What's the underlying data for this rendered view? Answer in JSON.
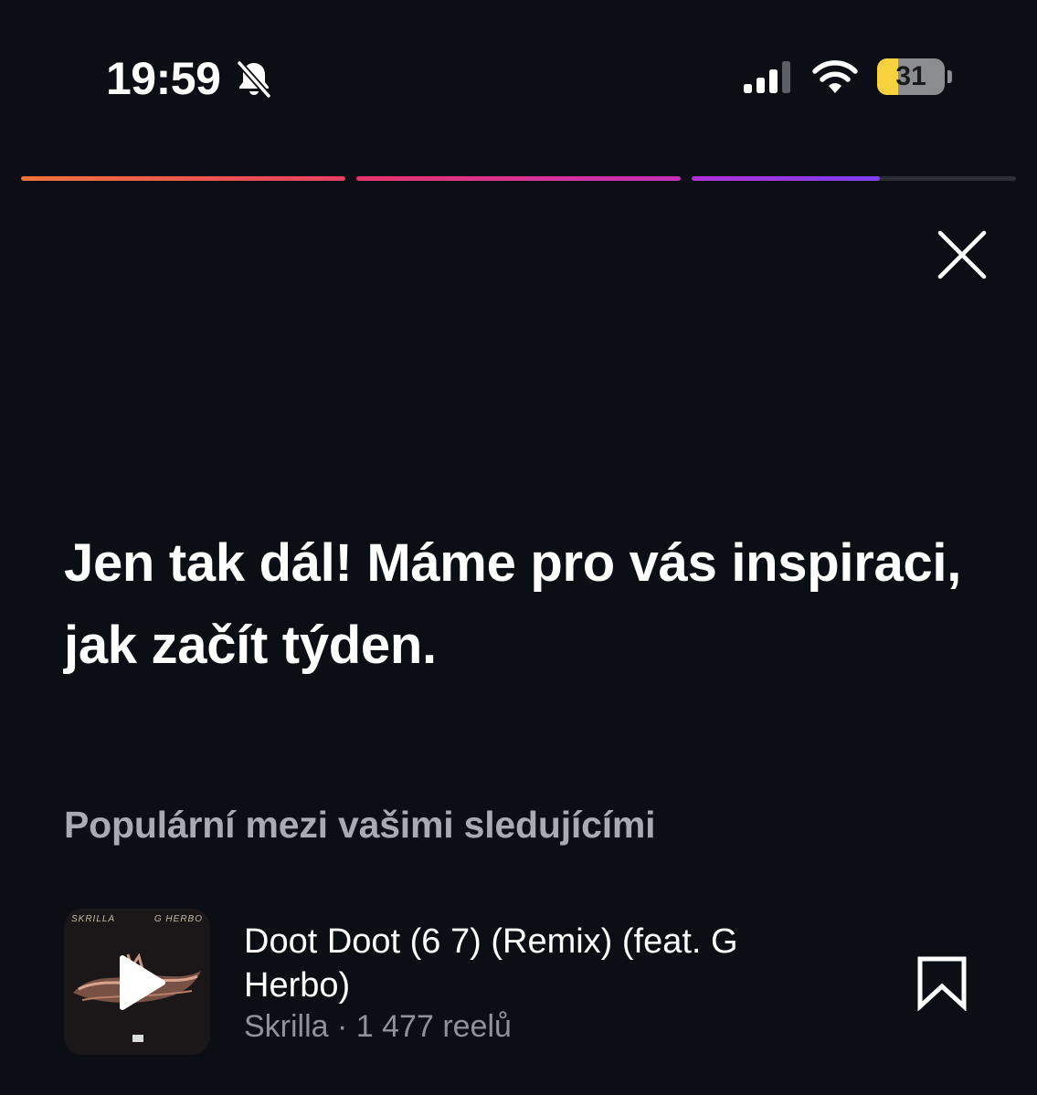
{
  "status_bar": {
    "time": "19:59",
    "battery_level": "31",
    "battery_fraction": 0.31
  },
  "story_progress": [
    {
      "fraction": 1.0,
      "colors": [
        "#f0743a",
        "#e83f62"
      ]
    },
    {
      "fraction": 1.0,
      "colors": [
        "#e8366b",
        "#c52fb8"
      ]
    },
    {
      "fraction": 0.58,
      "colors": [
        "#b231d6",
        "#7c3ff0"
      ]
    }
  ],
  "icons": {
    "close": "close-icon",
    "bell_off": "bell-off-icon",
    "signal": "cellular-signal-icon",
    "wifi": "wifi-icon",
    "play": "play-icon",
    "bookmark": "bookmark-icon"
  },
  "headline": "Jen tak dál! Máme pro vás inspiraci, jak začít týden.",
  "section_title": "Populární mezi vašimi sledujícími",
  "track": {
    "title": "Doot Doot (6 7) (Remix) (feat. G Herbo)",
    "meta": "Skrilla · 1 477 reelů",
    "cover": {
      "text_left": "SKRILLA",
      "text_right": "G HERBO"
    }
  },
  "colors": {
    "background": "#0b0e14",
    "text_primary": "#ffffff",
    "text_secondary": "#a7abb3",
    "text_meta": "#8e939b",
    "battery_fill": "#f7d23e"
  }
}
